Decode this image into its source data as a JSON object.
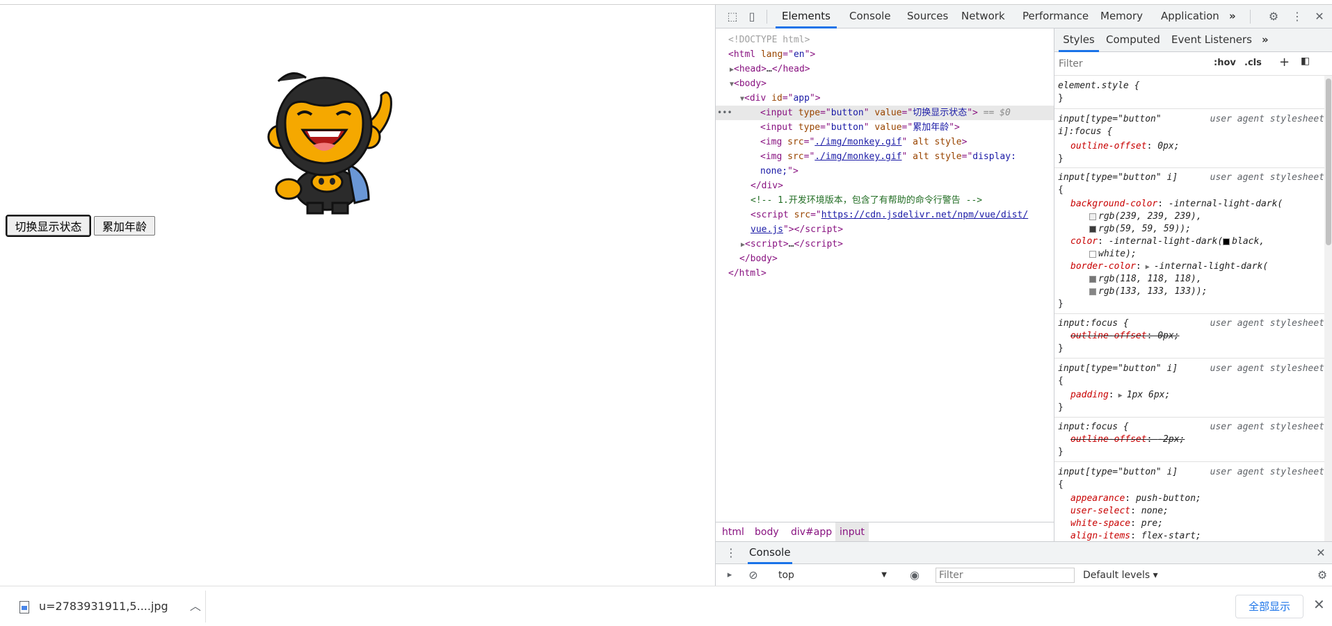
{
  "page": {
    "button_toggle": "切换显示状态",
    "button_age": "累加年龄"
  },
  "devtools": {
    "tabs": [
      "Elements",
      "Console",
      "Sources",
      "Network",
      "Performance",
      "Memory",
      "Application"
    ],
    "more_tabs": "»",
    "elements": {
      "doctype": "<!DOCTYPE html>",
      "html_open_tag": "html",
      "html_lang_attr": "lang",
      "html_lang_val": "en",
      "head": "head",
      "head_ellipsis": "…",
      "body": "body",
      "div_attr": "id",
      "div_val": "app",
      "input": "input",
      "type_attr": "type",
      "type_val": "button",
      "value_attr": "value",
      "input1_val": "切换显示状态",
      "input2_val": "累加年龄",
      "img": "img",
      "src_attr": "src",
      "img_src": "./img/monkey.gif",
      "alt_attr": "alt",
      "style_attr": "style",
      "img2_style_val_a": "display:",
      "img2_style_val_b": "none;",
      "eq_dollar": "== $0",
      "div_close": "div",
      "comment": "<!-- 1.开发环境版本，包含了有帮助的命令行警告 -->",
      "script": "script",
      "script_src_a": "https://cdn.jsdelivr.net/npm/vue/dist/",
      "script_src_b": "vue.js",
      "script_ellipsis": "…",
      "dots": "•••"
    },
    "breadcrumb": [
      "html",
      "body",
      "div#app",
      "input"
    ],
    "styles_tabs": [
      "Styles",
      "Computed",
      "Event Listeners"
    ],
    "filter_placeholder": "Filter",
    "hov": ":hov",
    "cls": ".cls",
    "plus": "+",
    "rules": {
      "element_style": "element.style {",
      "close": "}",
      "open": "{",
      "ua": "user agent stylesheet",
      "r1_sel_a": "input[type=\"button\"",
      "r1_sel_b": "i]:focus {",
      "outline_offset": "outline-offset",
      "r1_val": "0px;",
      "r2_sel": "input[type=\"button\" i]",
      "bg_color": "background-color",
      "bg_val": "-internal-light-dark(",
      "bg_c1": "rgb(239, 239, 239),",
      "bg_c2": "rgb(59, 59, 59));",
      "color": "color",
      "color_val": "-internal-light-dark(",
      "color_c1": "black,",
      "color_c2": "white);",
      "border_color": "border-color",
      "border_val": "-internal-light-dark(",
      "border_c1": "rgb(118, 118, 118),",
      "border_c2": "rgb(133, 133, 133));",
      "r3_sel": "input:focus {",
      "r3_val": "0px;",
      "r4_sel": "input[type=\"button\" i]",
      "padding": "padding",
      "padding_val": "1px 6px;",
      "r5_sel": "input:focus {",
      "r5_val": "-2px;",
      "r6_sel": "input[type=\"button\" i]",
      "appearance": "appearance",
      "appearance_val": "push-button;",
      "user_select": "user-select",
      "user_select_val": "none;",
      "white_space": "white-space",
      "white_space_val": "pre;",
      "align_items": "align-items",
      "align_items_val": "flex-start;"
    },
    "drawer": {
      "tab": "Console",
      "context": "top",
      "filter_placeholder": "Filter",
      "levels": "Default levels ▾"
    }
  },
  "download_bar": {
    "file": "u=2783931911,5....jpg",
    "show_all": "全部显示"
  }
}
